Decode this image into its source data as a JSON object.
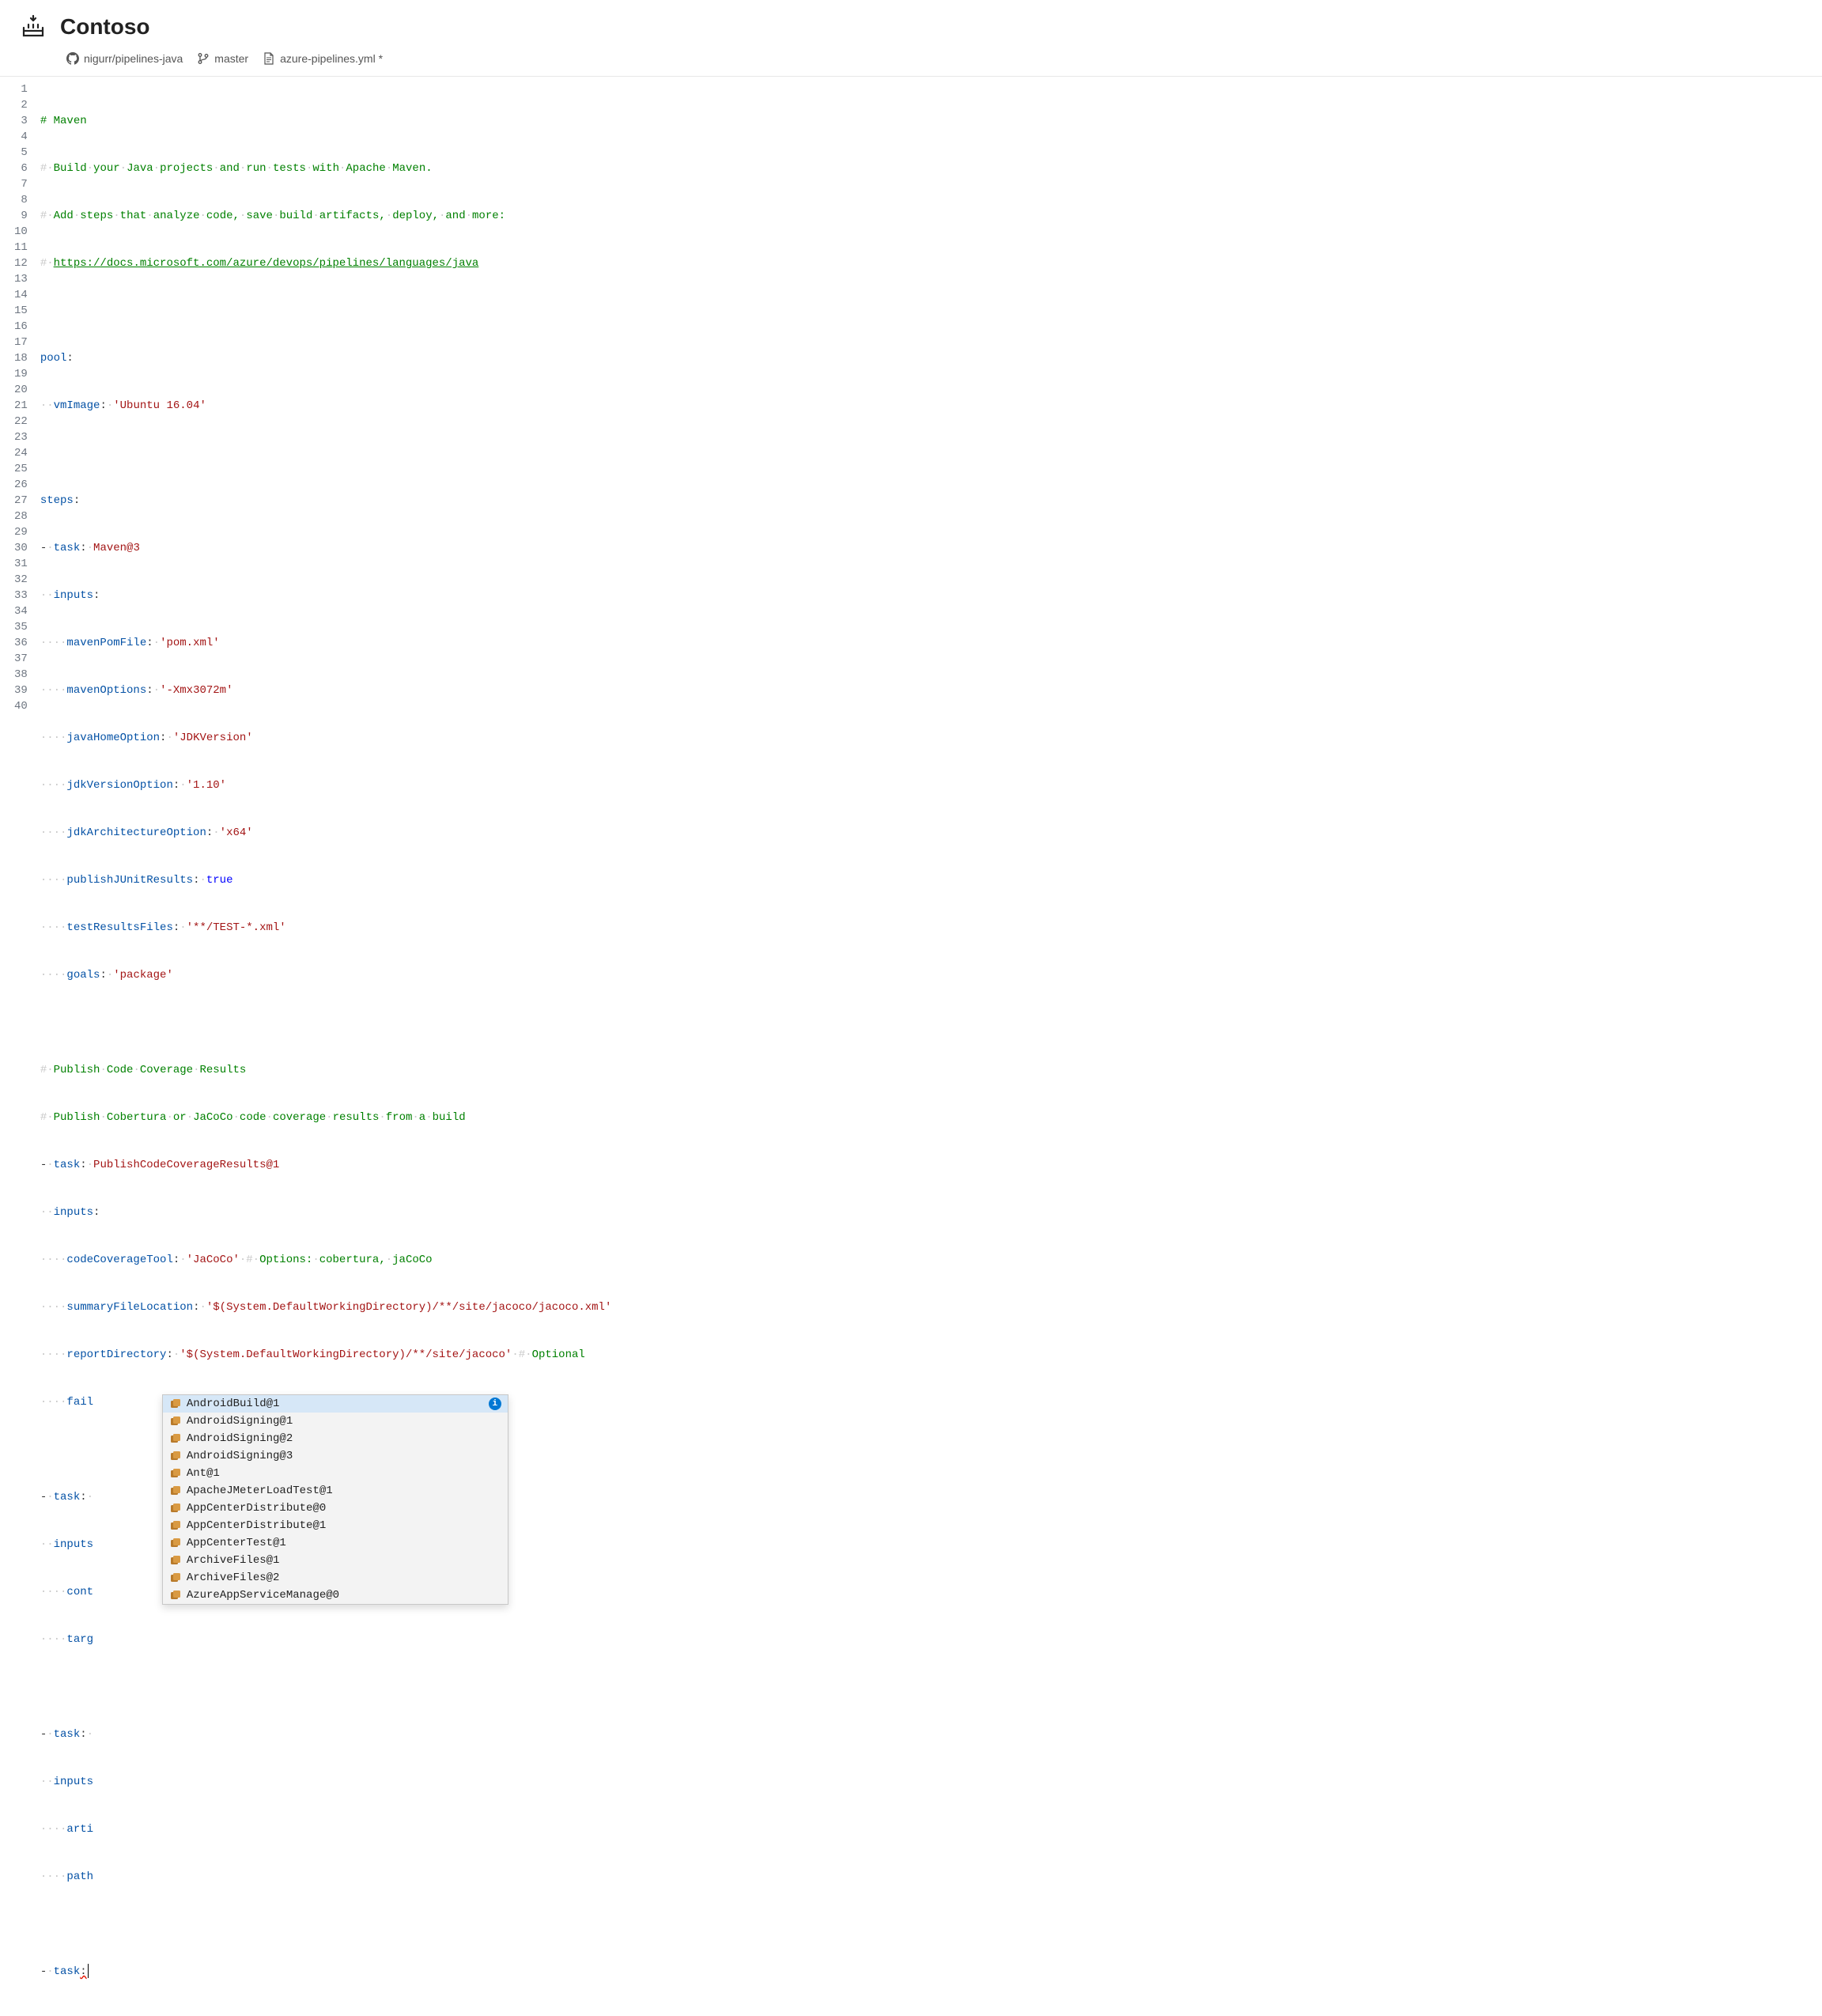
{
  "app": {
    "title": "Contoso"
  },
  "breadcrumb": {
    "repo": "nigurr/pipelines-java",
    "branch": "master",
    "file": "azure-pipelines.yml *"
  },
  "code": {
    "url_text": "https://docs.microsoft.com/azure/devops/pipelines/languages/java",
    "lines": {
      "1": "# Maven",
      "2_pre": "# Build your Java projects and run tests with Apache Maven.",
      "3_pre": "# Add steps that analyze code, save build artifacts, deploy, and more:",
      "6": "pool",
      "7_k": "vmImage",
      "7_v": "'Ubuntu 16.04'",
      "9": "steps",
      "10_k": "task",
      "10_v": "Maven@3",
      "11_k": "inputs",
      "12_k": "mavenPomFile",
      "12_v": "'pom.xml'",
      "13_k": "mavenOptions",
      "13_v": "'-Xmx3072m'",
      "14_k": "javaHomeOption",
      "14_v": "'JDKVersion'",
      "15_k": "jdkVersionOption",
      "15_v": "'1.10'",
      "16_k": "jdkArchitectureOption",
      "16_v": "'x64'",
      "17_k": "publishJUnitResults",
      "17_v": "true",
      "18_k": "testResultsFiles",
      "18_v": "'**/TEST-*.xml'",
      "19_k": "goals",
      "19_v": "'package'",
      "21": "# Publish Code Coverage Results",
      "22": "# Publish Cobertura or JaCoCo code coverage results from a build",
      "23_k": "task",
      "23_v": "PublishCodeCoverageResults@1",
      "24_k": "inputs",
      "25_k": "codeCoverageTool",
      "25_v": "'JaCoCo'",
      "25_c": "# Options: cobertura, jaCoCo",
      "26_k": "summaryFileLocation",
      "26_v": "'$(System.DefaultWorkingDirectory)/**/site/jacoco/jacoco.xml'",
      "27_k": "reportDirectory",
      "27_v": "'$(System.DefaultWorkingDirectory)/**/site/jacoco'",
      "27_c": "# Optional",
      "28_k": "fail",
      "30_k": "task",
      "31_k": "inputs",
      "32_k": "cont",
      "33_k": "targ",
      "35_k": "task",
      "36_k": "inputs",
      "37_k": "arti",
      "38_k": "path",
      "40_k": "task"
    }
  },
  "suggest": {
    "items": [
      {
        "label": "AndroidBuild@1",
        "selected": true
      },
      {
        "label": "AndroidSigning@1"
      },
      {
        "label": "AndroidSigning@2"
      },
      {
        "label": "AndroidSigning@3"
      },
      {
        "label": "Ant@1"
      },
      {
        "label": "ApacheJMeterLoadTest@1"
      },
      {
        "label": "AppCenterDistribute@0"
      },
      {
        "label": "AppCenterDistribute@1"
      },
      {
        "label": "AppCenterTest@1"
      },
      {
        "label": "ArchiveFiles@1"
      },
      {
        "label": "ArchiveFiles@2"
      },
      {
        "label": "AzureAppServiceManage@0"
      }
    ]
  },
  "gutter": [
    "1",
    "2",
    "3",
    "4",
    "5",
    "6",
    "7",
    "8",
    "9",
    "10",
    "11",
    "12",
    "13",
    "14",
    "15",
    "16",
    "17",
    "18",
    "19",
    "20",
    "21",
    "22",
    "23",
    "24",
    "25",
    "26",
    "27",
    "28",
    "29",
    "30",
    "31",
    "32",
    "33",
    "34",
    "35",
    "36",
    "37",
    "38",
    "39",
    "40"
  ]
}
